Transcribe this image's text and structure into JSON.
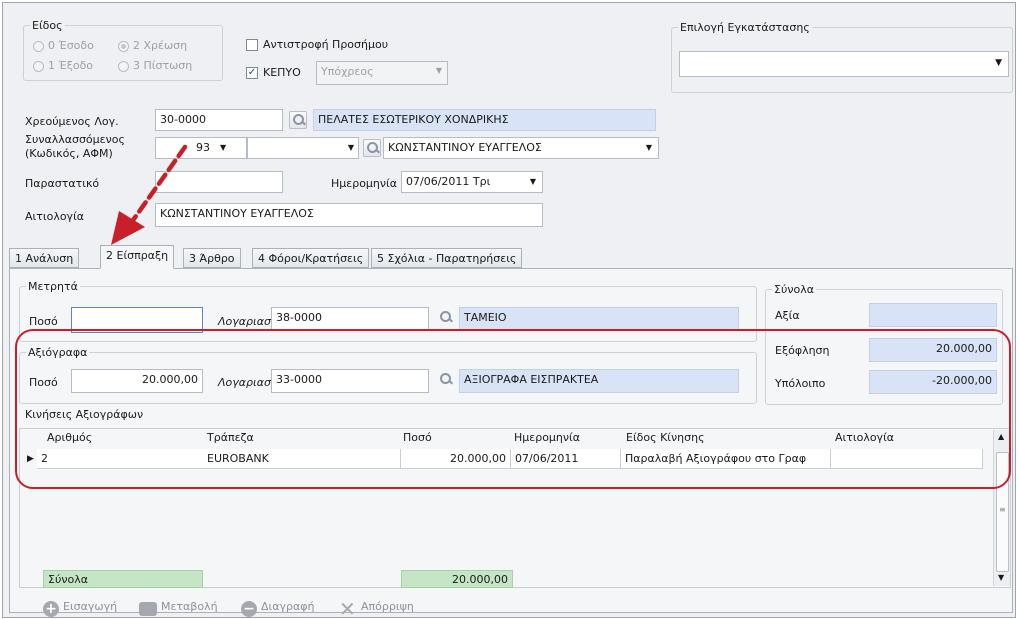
{
  "type_group": {
    "legend": "Είδος",
    "options": [
      "0 Έσοδο",
      "2 Χρέωση",
      "1 Έξοδο",
      "3 Πίστωση"
    ],
    "selected": "2 Χρέωση"
  },
  "reverse_charge": {
    "label": "Αντιστροφή Προσήμου",
    "checked": false
  },
  "kepyo": {
    "label": "ΚΕΠΥΟ",
    "checked": true,
    "select_value": "Υπόχρεος"
  },
  "facility": {
    "legend": "Επιλογή Εγκατάστασης",
    "value": ""
  },
  "debited_account": {
    "label": "Χρεούμενος Λογ.",
    "code": "30-0000",
    "name": "ΠΕΛΑΤΕΣ ΕΣΩΤΕΡΙΚΟΥ ΧΟΝΔΡΙΚΗΣ"
  },
  "counterparty": {
    "label_line1": "Συναλλασσόμενος",
    "label_line2": "(Κωδικός, ΑΦΜ)",
    "code": "93",
    "afm": "",
    "name": "ΚΩΝΣΤΑΝΤΙΝΟΥ ΕΥΑΓΓΕΛΟΣ"
  },
  "document": {
    "label": "Παραστατικό",
    "value": ""
  },
  "date": {
    "label": "Ημερομηνία",
    "value": "07/06/2011 Τρι"
  },
  "justification": {
    "label": "Αιτιολογία",
    "value": "ΚΩΝΣΤΑΝΤΙΝΟΥ ΕΥΑΓΓΕΛΟΣ"
  },
  "tabs": [
    {
      "label": "1 Ανάλυση",
      "active": false
    },
    {
      "label": "2 Είσπραξη",
      "active": true
    },
    {
      "label": "3 Άρθρο",
      "active": false
    },
    {
      "label": "4 Φόροι/Κρατήσεις",
      "active": false
    },
    {
      "label": "5 Σχόλια - Παρατηρήσεις",
      "active": false
    }
  ],
  "cash": {
    "legend": "Μετρητά",
    "amount_label": "Ποσό",
    "amount": "",
    "account_label": "Λογαριασμός",
    "account_code": "38-0000",
    "account_name": "ΤΑΜΕΙΟ"
  },
  "securities": {
    "legend": "Αξιόγραφα",
    "amount_label": "Ποσό",
    "amount": "20.000,00",
    "account_label": "Λογαριασμός",
    "account_code": "33-0000",
    "account_name": "ΑΞΙΟΓΡΑΦΑ ΕΙΣΠΡΑΚΤΕΑ"
  },
  "totals": {
    "legend": "Σύνολα",
    "value_label": "Αξία",
    "value": "",
    "settlement_label": "Εξόφληση",
    "settlement": "20.000,00",
    "balance_label": "Υπόλοιπο",
    "balance": "-20.000,00"
  },
  "movements": {
    "legend": "Κινήσεις Αξιογράφων",
    "columns": [
      "Αριθμός",
      "Τράπεζα",
      "Ποσό",
      "Ημερομηνία",
      "Είδος Κίνησης",
      "Αιτιολογία"
    ],
    "rows": [
      [
        "2",
        "EUROBANK",
        "20.000,00",
        "07/06/2011",
        "Παραλαβή Αξιογράφου στο Γραφ",
        ""
      ]
    ],
    "footer_label": "Σύνολα",
    "footer_amount": "20.000,00"
  },
  "toolbar": {
    "add": "Εισαγωγή",
    "edit": "Μεταβολή",
    "delete": "Διαγραφή",
    "discard": "Απόρριψη"
  },
  "colors": {
    "highlight_red": "#c8202a",
    "field_blue": "#d9e3f7",
    "total_green": "#c5e6c5"
  }
}
